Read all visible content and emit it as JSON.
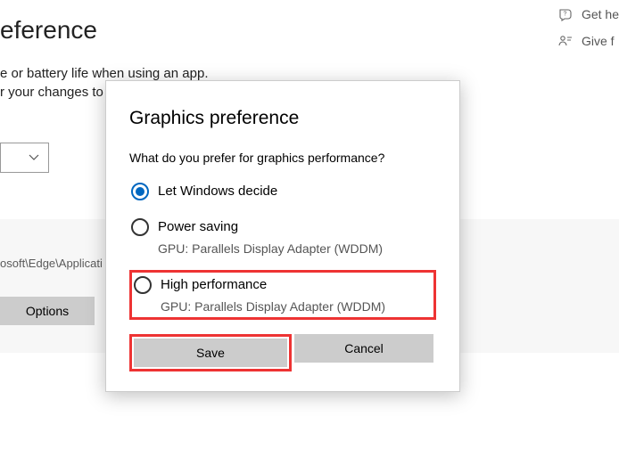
{
  "bg": {
    "title": "eference",
    "sub1": "e or battery life when using an app.",
    "sub2": "r your changes to take effect.",
    "appPath": "osoft\\Edge\\Applicati",
    "optionsLabel": "Options"
  },
  "rightLinks": {
    "help": "Get he",
    "feedback": "Give f"
  },
  "dialog": {
    "title": "Graphics preference",
    "subtitle": "What do you prefer for graphics performance?",
    "options": {
      "o0": {
        "label": "Let Windows decide"
      },
      "o1": {
        "label": "Power saving",
        "sub": "GPU: Parallels Display Adapter (WDDM)"
      },
      "o2": {
        "label": "High performance",
        "sub": "GPU: Parallels Display Adapter (WDDM)"
      }
    },
    "saveLabel": "Save",
    "cancelLabel": "Cancel"
  }
}
